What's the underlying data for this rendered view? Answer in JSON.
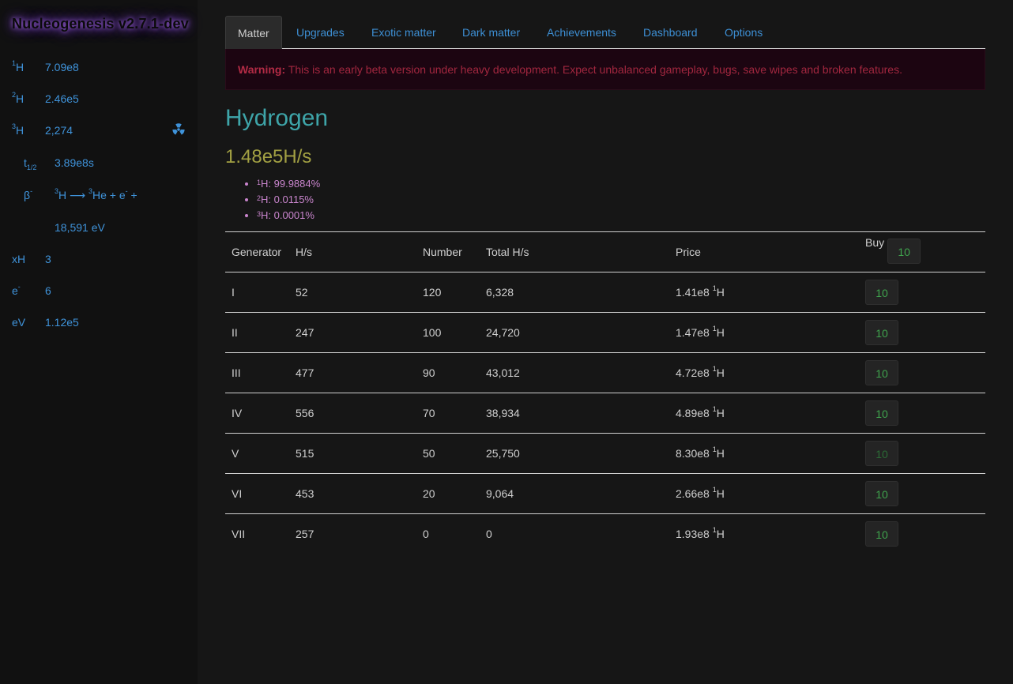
{
  "app": {
    "title": "Nucleogenesis v2.7.1-dev"
  },
  "sidebar": {
    "h1": {
      "sup": "1",
      "symbol": "H",
      "value": "7.09e8"
    },
    "h2": {
      "sup": "2",
      "symbol": "H",
      "value": "2.46e5"
    },
    "h3": {
      "sup": "3",
      "symbol": "H",
      "value": "2,274",
      "icon": "radioactive-icon"
    },
    "half_life": {
      "symbol": "t",
      "sub": "1/2",
      "value": "3.89e8s"
    },
    "decay": {
      "symbol": "β",
      "sup": "-",
      "reaction": {
        "from_sup": "3",
        "from": "H",
        "arrow": "⟶",
        "to_sup": "3",
        "to": "He + e",
        "to_sup2": "-",
        "tail": " +"
      },
      "energy": "18,591 eV"
    },
    "xh": {
      "label": "xH",
      "value": "3"
    },
    "electron": {
      "label": "e",
      "sup": "-",
      "value": "6"
    },
    "ev": {
      "label": "eV",
      "value": "1.12e5"
    }
  },
  "tabs": [
    "Matter",
    "Upgrades",
    "Exotic matter",
    "Dark matter",
    "Achievements",
    "Dashboard",
    "Options"
  ],
  "warning": {
    "label": "Warning:",
    "text": " This is an early beta version under heavy development. Expect unbalanced gameplay, bugs, save wipes and broken features."
  },
  "element": {
    "name": "Hydrogen",
    "rate": "1.48e5H/s"
  },
  "isotopes": [
    {
      "sup": "1",
      "text": "H: 99.9884%"
    },
    {
      "sup": "2",
      "text": "H: 0.0115%"
    },
    {
      "sup": "3",
      "text": "H: 0.0001%"
    }
  ],
  "table": {
    "headers": {
      "generator": "Generator",
      "rate": "H/s",
      "number": "Number",
      "total": "Total H/s",
      "price": "Price",
      "buy": "Buy",
      "buy_amount": "10"
    },
    "rows": [
      {
        "gen": "I",
        "rate": "52",
        "number": "120",
        "total": "6,328",
        "price": "1.41e8",
        "price_sup": "1",
        "price_unit": "H",
        "buy": "10"
      },
      {
        "gen": "II",
        "rate": "247",
        "number": "100",
        "total": "24,720",
        "price": "1.47e8",
        "price_sup": "1",
        "price_unit": "H",
        "buy": "10"
      },
      {
        "gen": "III",
        "rate": "477",
        "number": "90",
        "total": "43,012",
        "price": "4.72e8",
        "price_sup": "1",
        "price_unit": "H",
        "buy": "10"
      },
      {
        "gen": "IV",
        "rate": "556",
        "number": "70",
        "total": "38,934",
        "price": "4.89e8",
        "price_sup": "1",
        "price_unit": "H",
        "buy": "10"
      },
      {
        "gen": "V",
        "rate": "515",
        "number": "50",
        "total": "25,750",
        "price": "8.30e8",
        "price_sup": "1",
        "price_unit": "H",
        "buy": "10"
      },
      {
        "gen": "VI",
        "rate": "453",
        "number": "20",
        "total": "9,064",
        "price": "2.66e8",
        "price_sup": "1",
        "price_unit": "H",
        "buy": "10"
      },
      {
        "gen": "VII",
        "rate": "257",
        "number": "0",
        "total": "0",
        "price": "1.93e8",
        "price_sup": "1",
        "price_unit": "H",
        "buy": "10"
      }
    ]
  },
  "colors": {
    "accent": "#3d8fd4",
    "warning": "#a2273f",
    "element": "#3ea5a9",
    "rate": "#a2a043",
    "isotope": "#c985cd",
    "buy": "#3fa34d"
  }
}
